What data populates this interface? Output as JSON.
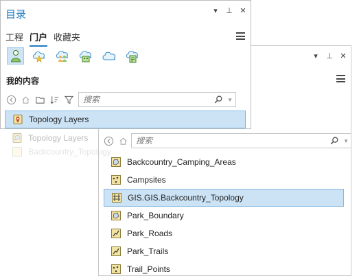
{
  "front_pane": {
    "title": "目录",
    "window_controls": [
      "▾",
      "⊥",
      "✕"
    ],
    "tabs": [
      {
        "label": "工程",
        "active": false
      },
      {
        "label": "门户",
        "active": true
      },
      {
        "label": "收藏夹",
        "active": false
      }
    ],
    "portal_icons": [
      "my-content-icon",
      "favorites-cloud-icon",
      "groups-cloud-icon",
      "organization-cloud-icon",
      "all-portal-icon",
      "living-atlas-icon"
    ],
    "section_label": "我的内容",
    "search": {
      "placeholder": "搜索"
    },
    "selected_item": {
      "label": "Topology Layers",
      "icon": "layer-package-icon"
    }
  },
  "drag_ghost": {
    "items": [
      {
        "label": "Topology Layers"
      },
      {
        "label": "Backcountry_Topology"
      }
    ]
  },
  "back_pane": {
    "window_controls": [
      "▾",
      "⊥",
      "✕"
    ],
    "search": {
      "placeholder": "搜索"
    },
    "items": [
      {
        "label": "Backcountry_Camping_Areas",
        "icon": "polygon-feature-class-icon",
        "selected": false
      },
      {
        "label": "Campsites",
        "icon": "point-feature-class-icon",
        "selected": false
      },
      {
        "label": "GIS.GIS.Backcountry_Topology",
        "icon": "topology-icon",
        "selected": true
      },
      {
        "label": "Park_Boundary",
        "icon": "polygon-feature-class-icon",
        "selected": false
      },
      {
        "label": "Park_Roads",
        "icon": "line-feature-class-icon",
        "selected": false
      },
      {
        "label": "Park_Trails",
        "icon": "line-feature-class-icon",
        "selected": false
      },
      {
        "label": "Trail_Points",
        "icon": "point-feature-class-icon",
        "selected": false
      }
    ]
  },
  "colors": {
    "accent": "#1f7bc1",
    "selection": "#cce3f5",
    "selection_border": "#84b6e0"
  }
}
